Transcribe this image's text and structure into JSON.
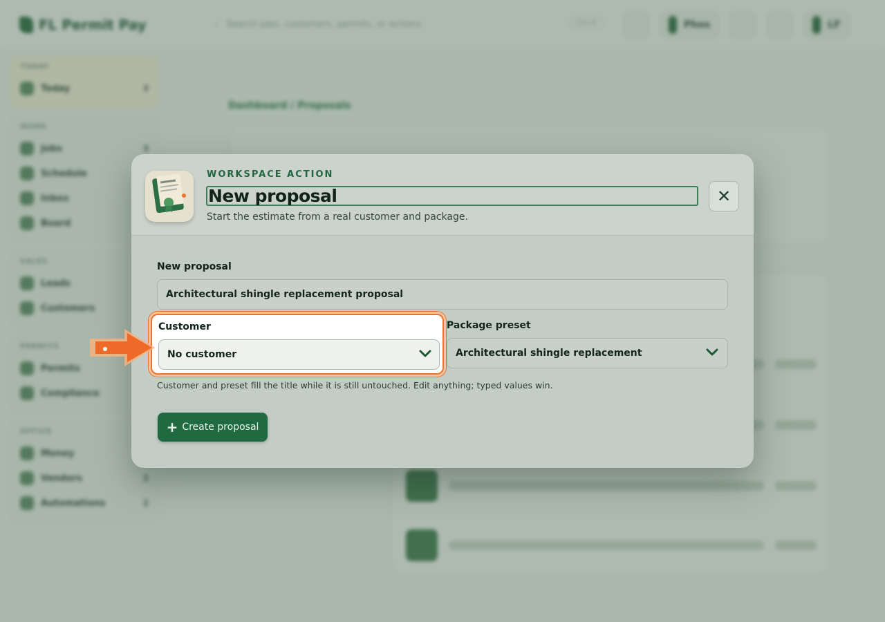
{
  "background": {
    "brand": "FL Permit Pay",
    "search_placeholder": "Search jobs, customers, permits, or actions",
    "search_shortcut": "Ctrl K",
    "user_name": "Phos",
    "user_initials": "LF",
    "breadcrumb": "Dashboard / Proposals",
    "sidebar": [
      {
        "head": "TODAY",
        "items": [
          {
            "label": "Today",
            "count": "3"
          }
        ]
      },
      {
        "head": "WORK",
        "items": [
          {
            "label": "Jobs",
            "count": "3"
          },
          {
            "label": "Schedule",
            "count": ""
          },
          {
            "label": "Inbox",
            "count": ""
          },
          {
            "label": "Board",
            "count": ""
          }
        ]
      },
      {
        "head": "SALES",
        "items": [
          {
            "label": "Leads",
            "count": ""
          },
          {
            "label": "Customers",
            "count": ""
          }
        ]
      },
      {
        "head": "PERMITS",
        "items": [
          {
            "label": "Permits",
            "count": ""
          },
          {
            "label": "Compliance",
            "count": ""
          }
        ]
      },
      {
        "head": "OFFICE",
        "items": [
          {
            "label": "Money",
            "count": ""
          },
          {
            "label": "Vendors",
            "count": "2"
          },
          {
            "label": "Automations",
            "count": "2"
          }
        ]
      }
    ]
  },
  "modal": {
    "eyebrow": "WORKSPACE ACTION",
    "title": "New proposal",
    "subtitle": "Start the estimate from a real customer and package.",
    "close_label": "✕",
    "proposal_label": "New proposal",
    "proposal_value": "Architectural shingle replacement proposal",
    "customer_label": "Customer",
    "customer_value": "No customer",
    "preset_label": "Package preset",
    "preset_value": "Architectural shingle replacement",
    "help_text": "Customer and preset fill the title while it is still untouched. Edit anything; typed values win.",
    "create_button": "Create proposal",
    "create_icon": "+"
  },
  "colors": {
    "accent": "#1f6a40",
    "highlight": "#e8742f"
  },
  "icons": {
    "header": "proposal-document-icon",
    "close": "close-icon",
    "chevron": "chevron-down-icon",
    "pointer": "pointer-arrow-icon"
  }
}
